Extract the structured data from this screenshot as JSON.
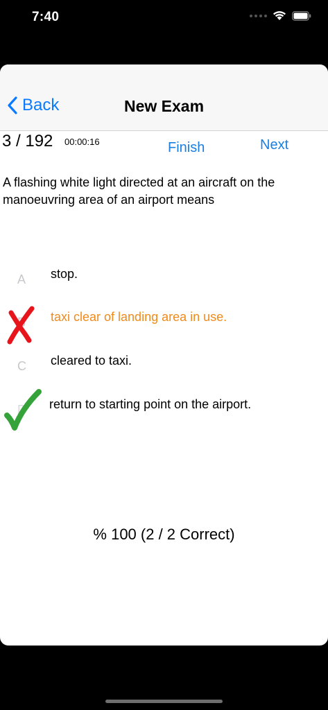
{
  "status_bar": {
    "time": "7:40"
  },
  "nav": {
    "back_label": "Back",
    "title": "New Exam"
  },
  "exam": {
    "counter": "3 / 192",
    "timer": "00:00:16",
    "finish_label": "Finish",
    "next_label": "Next",
    "question": "A flashing white light directed at an aircraft on the manoeuvring area of an airport means"
  },
  "answers": [
    {
      "letter": "A",
      "text": "stop.",
      "state": "none"
    },
    {
      "letter": "B",
      "text": "taxi clear of landing area in use.",
      "state": "wrong"
    },
    {
      "letter": "C",
      "text": "cleared to taxi.",
      "state": "none"
    },
    {
      "letter": "D",
      "text": "return to starting point on the airport.",
      "state": "correct"
    }
  ],
  "score": "% 100 (2 / 2 Correct)",
  "icons": {
    "back": "chevron-left-icon",
    "wrong": "red-cross-icon",
    "correct": "green-check-icon",
    "wifi": "wifi-icon",
    "battery": "battery-icon"
  },
  "colors": {
    "accent": "#0a7aff",
    "wrong_answer": "#f08a1a",
    "wrong_mark": "#e8141c",
    "correct_mark": "#36a33a"
  }
}
